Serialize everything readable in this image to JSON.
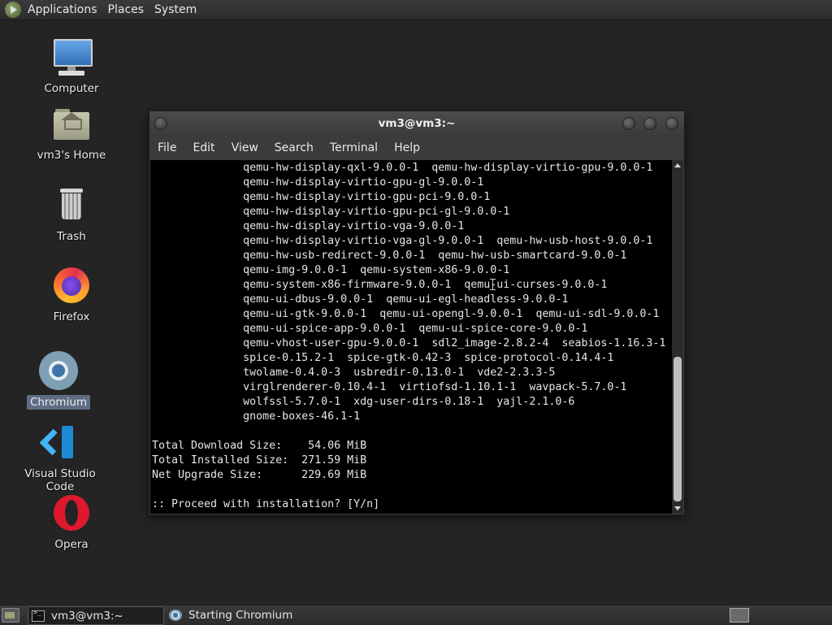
{
  "top_panel": {
    "menus": [
      "Applications",
      "Places",
      "System"
    ]
  },
  "desktop": {
    "icons": [
      {
        "label": "Computer"
      },
      {
        "label": "vm3's Home"
      },
      {
        "label": "Trash"
      },
      {
        "label": "Firefox"
      },
      {
        "label": "Chromium"
      },
      {
        "label": "Visual Studio Code"
      },
      {
        "label": "Opera"
      }
    ]
  },
  "terminal": {
    "title": "vm3@vm3:~",
    "menu": [
      "File",
      "Edit",
      "View",
      "Search",
      "Terminal",
      "Help"
    ],
    "lines": [
      "              qemu-hw-display-qxl-9.0.0-1  qemu-hw-display-virtio-gpu-9.0.0-1",
      "              qemu-hw-display-virtio-gpu-gl-9.0.0-1",
      "              qemu-hw-display-virtio-gpu-pci-9.0.0-1",
      "              qemu-hw-display-virtio-gpu-pci-gl-9.0.0-1",
      "              qemu-hw-display-virtio-vga-9.0.0-1",
      "              qemu-hw-display-virtio-vga-gl-9.0.0-1  qemu-hw-usb-host-9.0.0-1",
      "              qemu-hw-usb-redirect-9.0.0-1  qemu-hw-usb-smartcard-9.0.0-1",
      "              qemu-img-9.0.0-1  qemu-system-x86-9.0.0-1",
      "              qemu-system-x86-firmware-9.0.0-1  qemu-ui-curses-9.0.0-1",
      "              qemu-ui-dbus-9.0.0-1  qemu-ui-egl-headless-9.0.0-1",
      "              qemu-ui-gtk-9.0.0-1  qemu-ui-opengl-9.0.0-1  qemu-ui-sdl-9.0.0-1",
      "              qemu-ui-spice-app-9.0.0-1  qemu-ui-spice-core-9.0.0-1",
      "              qemu-vhost-user-gpu-9.0.0-1  sdl2_image-2.8.2-4  seabios-1.16.3-1",
      "              spice-0.15.2-1  spice-gtk-0.42-3  spice-protocol-0.14.4-1",
      "              twolame-0.4.0-3  usbredir-0.13.0-1  vde2-2.3.3-5",
      "              virglrenderer-0.10.4-1  virtiofsd-1.10.1-1  wavpack-5.7.0-1",
      "              wolfssl-5.7.0-1  xdg-user-dirs-0.18-1  yajl-2.1.0-6",
      "              gnome-boxes-46.1-1",
      "",
      "Total Download Size:    54.06 MiB",
      "Total Installed Size:  271.59 MiB",
      "Net Upgrade Size:      229.69 MiB",
      "",
      ":: Proceed with installation? [Y/n]"
    ]
  },
  "taskbar": {
    "tasks": [
      {
        "label": "vm3@vm3:~",
        "icon": "terminal-icon",
        "active": true
      },
      {
        "label": "Starting Chromium",
        "icon": "chromium-icon",
        "active": false
      }
    ]
  }
}
